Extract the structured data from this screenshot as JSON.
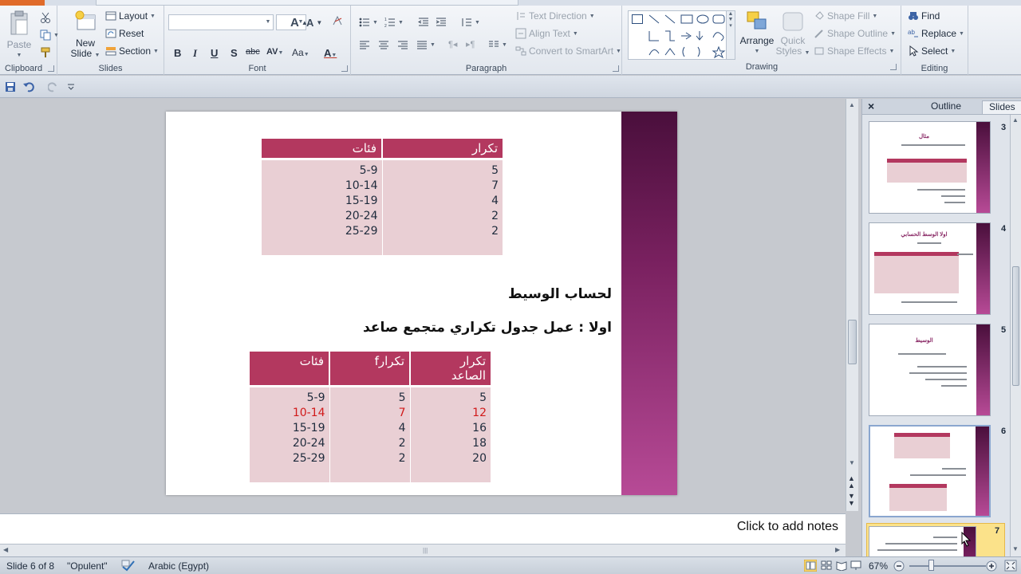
{
  "ribbon": {
    "clipboard": {
      "paste": "Paste",
      "group": "Clipboard"
    },
    "slides": {
      "new_slide": "New Slide",
      "new_slide_l1": "New",
      "new_slide_l2": "Slide",
      "layout": "Layout",
      "reset": "Reset",
      "section": "Section",
      "group": "Slides"
    },
    "font": {
      "group": "Font",
      "bold": "B",
      "italic": "I",
      "underline": "U",
      "shadow": "S",
      "strike": "abc",
      "spacing": "AV",
      "case": "Aa",
      "color": "A"
    },
    "paragraph": {
      "group": "Paragraph",
      "text_direction": "Text Direction",
      "align_text": "Align Text",
      "convert_smartart": "Convert to SmartArt"
    },
    "drawing": {
      "group": "Drawing",
      "arrange": "Arrange",
      "quick_styles_l1": "Quick",
      "quick_styles_l2": "Styles",
      "shape_fill": "Shape Fill",
      "shape_outline": "Shape Outline",
      "shape_effects": "Shape Effects"
    },
    "editing": {
      "group": "Editing",
      "find": "Find",
      "replace": "Replace",
      "select": "Select"
    }
  },
  "slide": {
    "table1": {
      "headers": [
        "فئات",
        "تكرار"
      ],
      "categories": [
        "5-9",
        "10-14",
        "15-19",
        "20-24",
        "25-29"
      ],
      "freq": [
        "5",
        "7",
        "4",
        "2",
        "2"
      ]
    },
    "heading1": "لحساب الوسيط",
    "heading2": "اولا : عمل جدول تكراري متجمع صاعد",
    "table2": {
      "headers": [
        "فئات",
        "تكرارf",
        "تكرار الصاعد"
      ],
      "header3_l1": "تكرار",
      "header3_l2": "الصاعد",
      "categories": [
        "5-9",
        "10-14",
        "15-19",
        "20-24",
        "25-29"
      ],
      "freq": [
        "5",
        "7",
        "4",
        "2",
        "2"
      ],
      "cumulative": [
        "5",
        "12",
        "16",
        "18",
        "20"
      ],
      "highlight_row": 1,
      "highlight_color": "#d11a1a"
    }
  },
  "notes": {
    "placeholder": "Click to add notes"
  },
  "pane": {
    "tab_outline": "Outline",
    "tab_slides": "Slides",
    "thumbs": [
      {
        "num": "3",
        "title": "مثال"
      },
      {
        "num": "4",
        "title": "اولا الوسط الحسابي"
      },
      {
        "num": "5",
        "title": "الوسيط"
      },
      {
        "num": "6",
        "title": ""
      },
      {
        "num": "7",
        "title": ""
      }
    ]
  },
  "status": {
    "slide_info": "Slide 6 of 8",
    "theme": "\"Opulent\"",
    "language": "Arabic (Egypt)",
    "zoom": "67%"
  },
  "colors": {
    "accent": "#b3385f",
    "table_fill": "#e9cfd4",
    "slide_bar_top": "#4a0f3c",
    "slide_bar_bottom": "#b74a96"
  }
}
